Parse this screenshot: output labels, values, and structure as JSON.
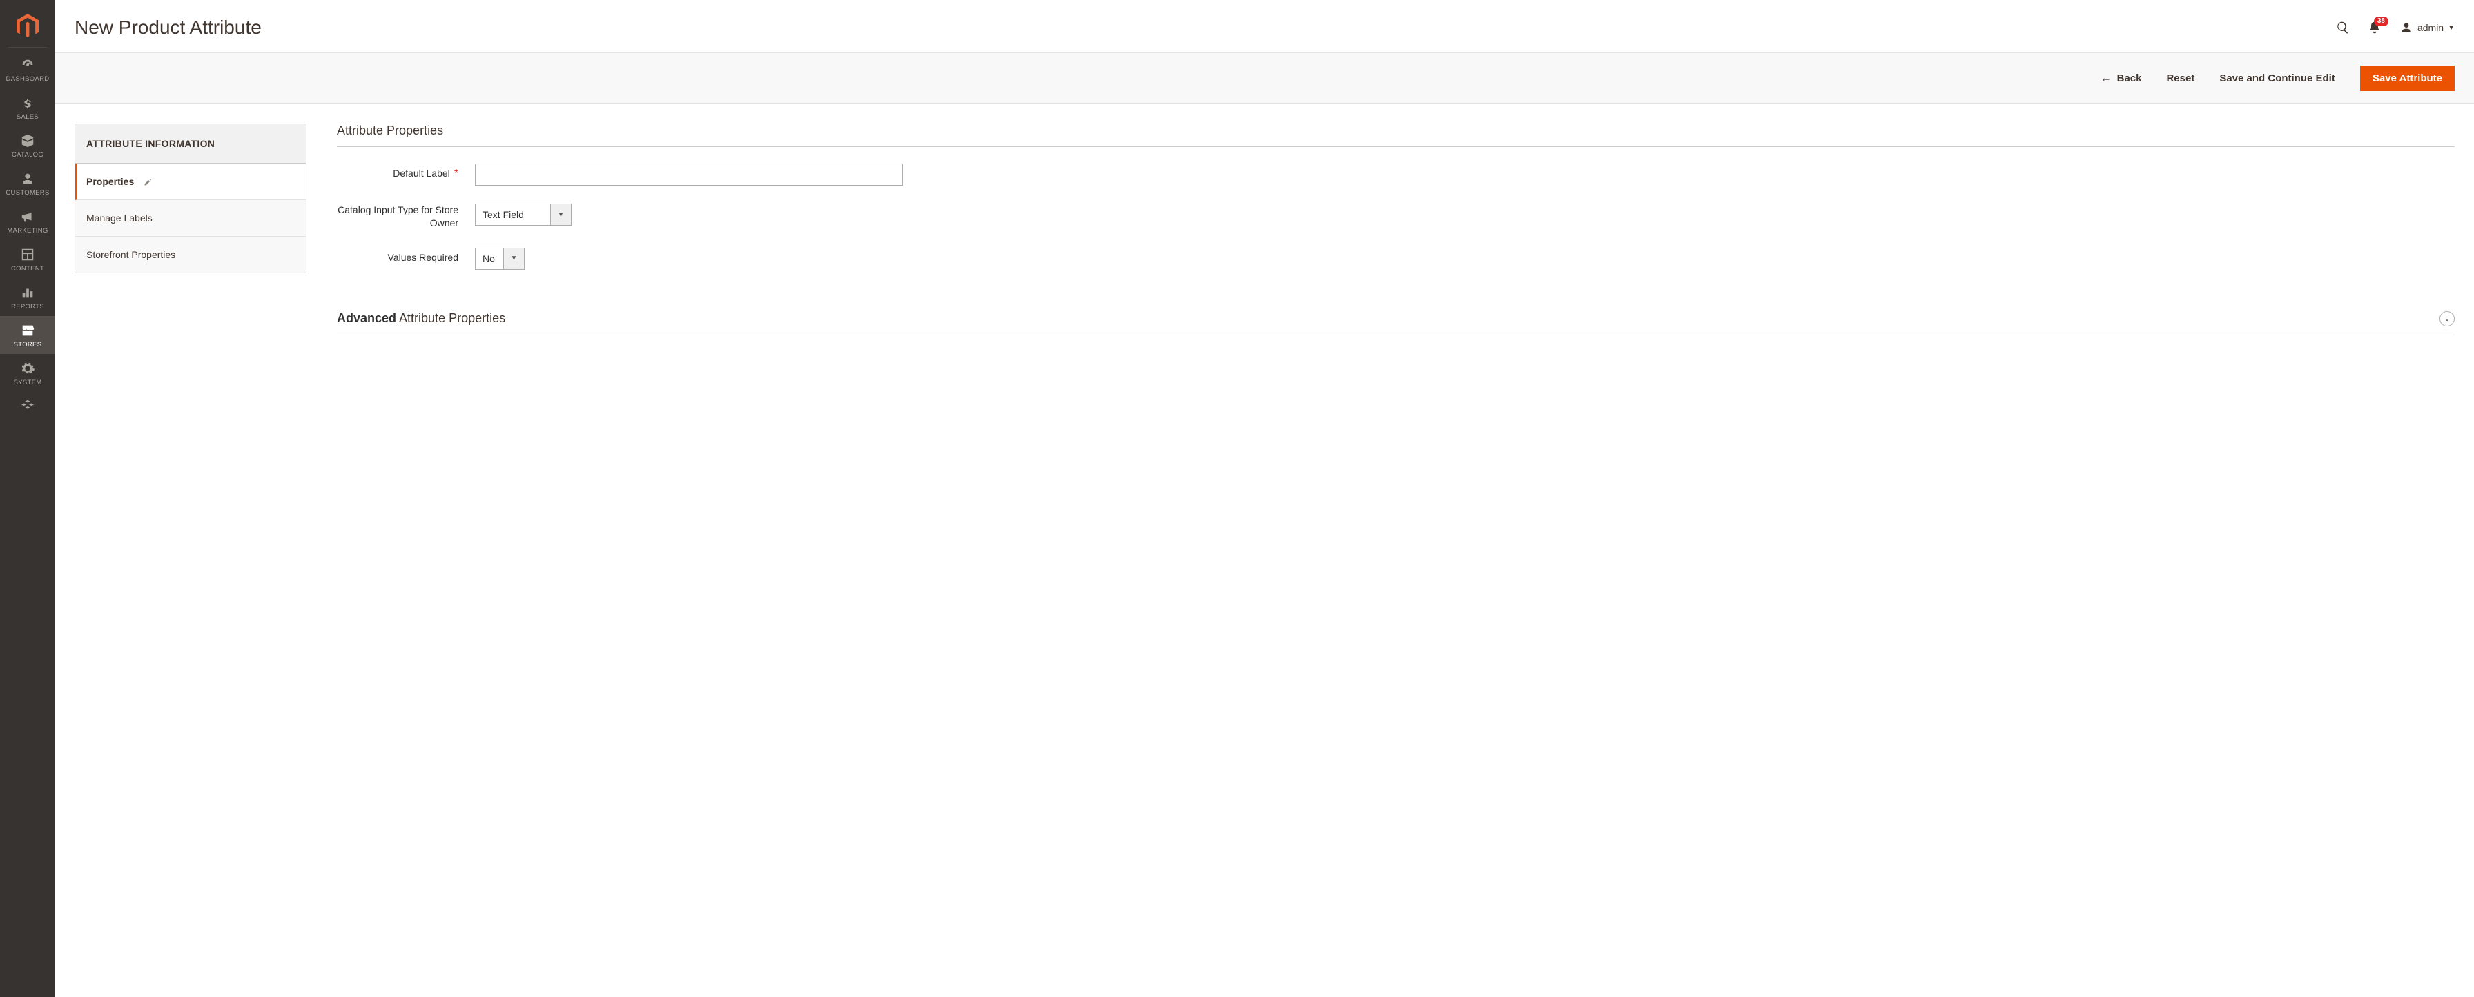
{
  "sidebar": {
    "items": [
      {
        "label": "DASHBOARD"
      },
      {
        "label": "SALES"
      },
      {
        "label": "CATALOG"
      },
      {
        "label": "CUSTOMERS"
      },
      {
        "label": "MARKETING"
      },
      {
        "label": "CONTENT"
      },
      {
        "label": "REPORTS"
      },
      {
        "label": "STORES"
      },
      {
        "label": "SYSTEM"
      }
    ]
  },
  "header": {
    "title": "New Product Attribute",
    "notification_count": "38",
    "user_label": "admin"
  },
  "actions": {
    "back": "Back",
    "reset": "Reset",
    "save_continue": "Save and Continue Edit",
    "save": "Save Attribute"
  },
  "tabs": {
    "title": "ATTRIBUTE INFORMATION",
    "items": [
      {
        "label": "Properties"
      },
      {
        "label": "Manage Labels"
      },
      {
        "label": "Storefront Properties"
      }
    ]
  },
  "section1": {
    "title": "Attribute Properties",
    "default_label_label": "Default Label",
    "default_label_value": "",
    "input_type_label": "Catalog Input Type for Store Owner",
    "input_type_value": "Text Field",
    "values_required_label": "Values Required",
    "values_required_value": "No"
  },
  "section2": {
    "title_strong": "Advanced",
    "title_rest": " Attribute Properties"
  }
}
